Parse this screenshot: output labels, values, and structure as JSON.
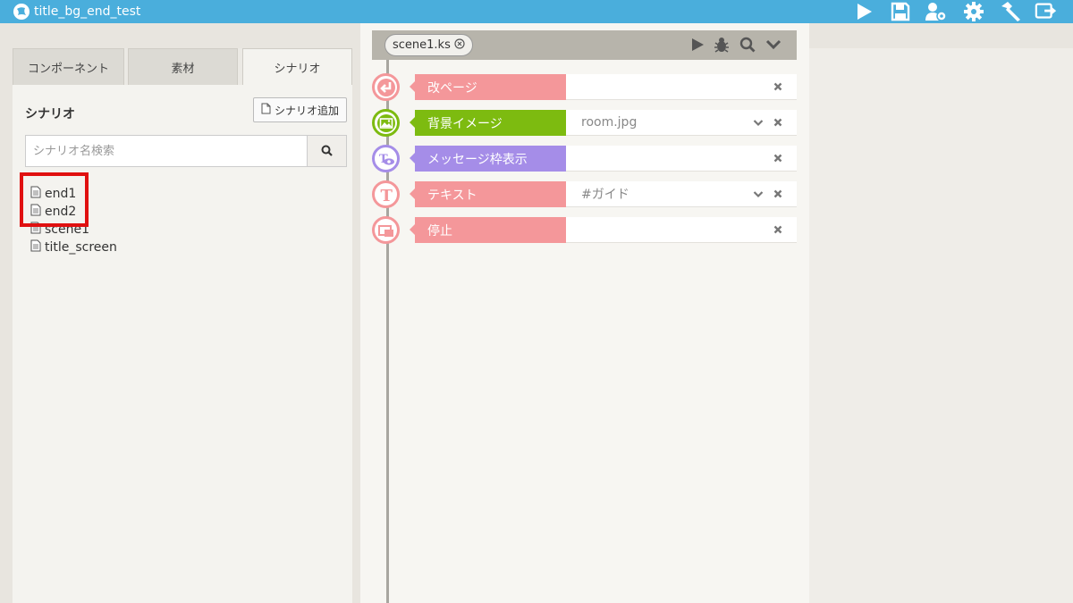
{
  "app": {
    "title": "title_bg_end_test",
    "accent_color": "#4aaedc",
    "toolbar_icons": [
      "play-icon",
      "save-icon",
      "user-settings-icon",
      "gear-icon",
      "hammer-icon",
      "export-icon"
    ]
  },
  "left_panel": {
    "tabs": [
      {
        "label": "コンポーネント",
        "active": false
      },
      {
        "label": "素材",
        "active": false
      },
      {
        "label": "シナリオ",
        "active": true
      }
    ],
    "section_title": "シナリオ",
    "add_button_label": "シナリオ追加",
    "search_placeholder": "シナリオ名検索",
    "files": [
      {
        "name": "end1"
      },
      {
        "name": "end2"
      },
      {
        "name": "scene1"
      },
      {
        "name": "title_screen"
      }
    ],
    "highlight_color": "#e01010"
  },
  "editor": {
    "file_tab_label": "scene1.ks",
    "toolbar_icons": [
      "play-icon",
      "bug-icon",
      "search-icon",
      "chevron-down-icon"
    ],
    "commands": [
      {
        "label": "改ページ",
        "value": "",
        "color": "#f4979a",
        "icon": "page-break-icon",
        "has_dropdown": false
      },
      {
        "label": "背景イメージ",
        "value": "room.jpg",
        "color": "#7dbb10",
        "icon": "background-image-icon",
        "has_dropdown": true
      },
      {
        "label": "メッセージ枠表示",
        "value": "",
        "color": "#a58de8",
        "icon": "message-window-icon",
        "has_dropdown": false
      },
      {
        "label": "テキスト",
        "value": "#ガイド",
        "color": "#f4979a",
        "icon": "text-icon",
        "has_dropdown": true
      },
      {
        "label": "停止",
        "value": "",
        "color": "#f4979a",
        "icon": "stop-icon",
        "has_dropdown": false
      }
    ]
  }
}
